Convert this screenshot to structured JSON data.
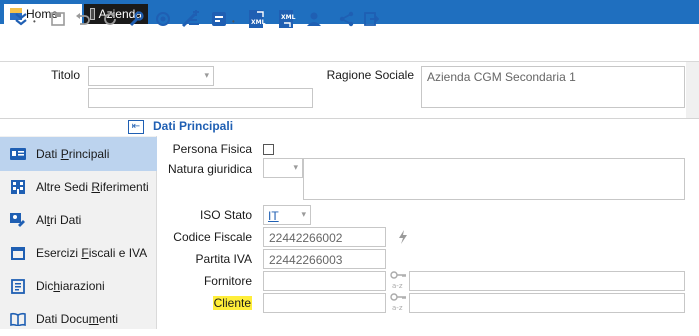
{
  "tabs": [
    {
      "label": "Home"
    },
    {
      "label": "Azienda"
    }
  ],
  "header": {
    "titolo_label": "Titolo",
    "titolo_value": "",
    "titolo_line2": "",
    "ragione_sociale_label": "Ragione Sociale",
    "ragione_sociale_value": "Azienda CGM Secondaria 1"
  },
  "section": {
    "title": "Dati Principali",
    "collapse_glyph": "⇤"
  },
  "sidebar": {
    "items": [
      {
        "pre": "Dati ",
        "accel": "P",
        "post": "rincipali",
        "icon": "id-card-icon"
      },
      {
        "pre": "Altre Sedi ",
        "accel": "R",
        "post": "iferimenti",
        "icon": "building-icon"
      },
      {
        "pre": "Al",
        "accel": "t",
        "post": "ri Dati",
        "icon": "user-edit-icon"
      },
      {
        "pre": "Esercizi ",
        "accel": "F",
        "post": "iscali e IVA",
        "icon": "calendar-icon"
      },
      {
        "pre": "Dic",
        "accel": "h",
        "post": "iarazioni",
        "icon": "document-icon"
      },
      {
        "pre": "Dati Docu",
        "accel": "m",
        "post": "enti",
        "icon": "book-icon"
      }
    ]
  },
  "form": {
    "persona_fisica_label": "Persona Fisica",
    "natura_giuridica_label": "Natura giuridica",
    "natura_giuridica_value": "",
    "iso_stato_label": "ISO Stato",
    "iso_stato_value": "IT",
    "codice_fiscale_label": "Codice Fiscale",
    "codice_fiscale_value": "22442266002",
    "partita_iva_label": "Partita IVA",
    "partita_iva_value": "22442266003",
    "fornitore_label": "Fornitore",
    "fornitore_value": "",
    "cliente_label": "Cliente",
    "cliente_value": "",
    "key_icon_text": "a-z"
  },
  "colors": {
    "tabbar": "#1f6fbf",
    "accent": "#1f5fb3",
    "sidebar_active": "#bcd3ee",
    "highlight": "#ffee3a"
  }
}
